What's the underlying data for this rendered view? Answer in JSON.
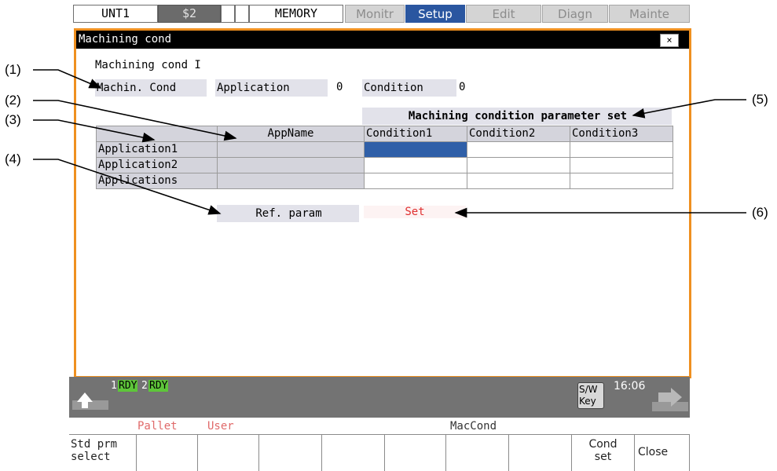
{
  "top_bar": {
    "unit": "UNT1",
    "part_system": "$2",
    "mode": "MEMORY",
    "tabs": [
      {
        "label": "Monitr",
        "active": false
      },
      {
        "label": "Setup",
        "active": true
      },
      {
        "label": "Edit",
        "active": false
      },
      {
        "label": "Diagn",
        "active": false
      },
      {
        "label": "Mainte",
        "active": false
      }
    ]
  },
  "window": {
    "title": "Machining cond",
    "close_label": "×",
    "subtitle": "Machining cond I",
    "machin_cond_label": "Machin. Cond",
    "application_label": "Application",
    "application_value": "0",
    "condition_label": "Condition",
    "condition_value": "0",
    "param_set_heading": "Machining condition parameter set",
    "table": {
      "headers": [
        "",
        "AppName",
        "Condition1",
        "Condition2",
        "Condition3"
      ],
      "rows": [
        {
          "label": "Application1",
          "app_name": "",
          "c1": "",
          "c2": "",
          "c3": ""
        },
        {
          "label": "Application2",
          "app_name": "",
          "c1": "",
          "c2": "",
          "c3": ""
        },
        {
          "label": "Applications",
          "app_name": "",
          "c1": "",
          "c2": "",
          "c3": ""
        }
      ]
    },
    "ref_param_label": "Ref. param",
    "ref_param_value": "Set"
  },
  "status_bar": {
    "rdy1_num": "1",
    "rdy1": "RDY",
    "rdy2_num": "2",
    "rdy2": "RDY",
    "sw_key": "S/W\nKey",
    "time": "16:06"
  },
  "menu_labels": {
    "pallet": "Pallet",
    "user": "User",
    "maccond": "MacCond"
  },
  "function_keys": [
    "Std prm\nselect",
    "",
    "",
    "",
    "",
    "",
    "",
    "",
    "Cond\nset",
    "Close"
  ],
  "annotations": [
    "(1)",
    "(2)",
    "(3)",
    "(4)",
    "(5)",
    "(6)"
  ],
  "colors": {
    "window_border": "#ef9020",
    "active_tab": "#2a56a0",
    "rdy_green": "#5ec63a",
    "selected_cell": "#2f5fa8",
    "set_value": "#e03030"
  }
}
